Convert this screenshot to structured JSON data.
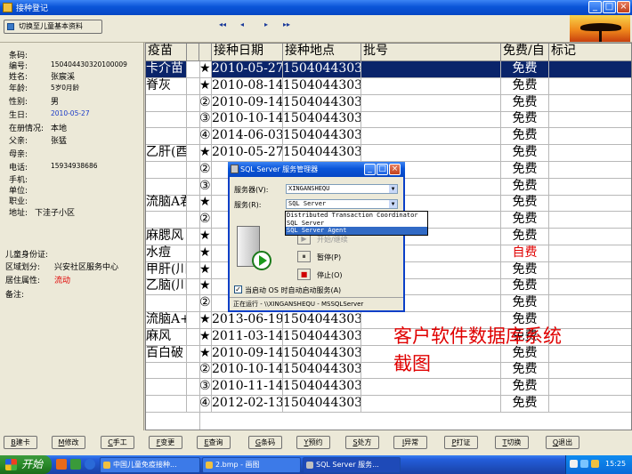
{
  "window": {
    "title": "接种登记",
    "min": "_",
    "max": "□",
    "close": "×"
  },
  "toolbar": {
    "switch_label": "切换至儿童基本资料",
    "nav": [
      "◂◂",
      "◂",
      "▸",
      "▸▸"
    ]
  },
  "left": {
    "fields": [
      {
        "label": "条码:",
        "value": ""
      },
      {
        "label": "编号:",
        "value": "150404430320100009"
      },
      {
        "label": "姓名:",
        "value": "张宸溪"
      },
      {
        "label": "年龄:",
        "value": "5岁0月龄"
      },
      {
        "label": "性别:",
        "value": "男"
      },
      {
        "label": "生日:",
        "value": "2010-05-27"
      },
      {
        "label": "在册情况:",
        "value": "本地"
      },
      {
        "label": "父亲:",
        "value": "张猛"
      },
      {
        "label": "母亲:",
        "value": ""
      },
      {
        "label": "电话:",
        "value": "15934938686"
      },
      {
        "label": "手机:",
        "value": ""
      },
      {
        "label": "单位:",
        "value": ""
      },
      {
        "label": "职业:",
        "value": ""
      },
      {
        "label": "地址:",
        "value": "下洼子小区"
      }
    ],
    "fields2": [
      {
        "label": "儿童身份证:",
        "value": ""
      },
      {
        "label": "区域划分:",
        "value": "兴安社区服务中心"
      },
      {
        "label": "居住属性:",
        "value": "流动"
      },
      {
        "label": "备注:",
        "value": ""
      }
    ],
    "colors": {
      "birthday": "#1a3ac8",
      "residence": "#e00000"
    }
  },
  "grid": {
    "headers": [
      "疫苗",
      "",
      "接种日期",
      "接种地点",
      "批号",
      "免费/自",
      "标记"
    ],
    "rows": [
      [
        "卡介苗",
        "★①",
        "2010-05-27",
        "1504044303",
        "",
        "免费",
        ""
      ],
      [
        "脊灰",
        "★①",
        "2010-08-14",
        "1504044303",
        "",
        "免费",
        ""
      ],
      [
        "",
        "②",
        "2010-09-14",
        "1504044303",
        "",
        "免费",
        ""
      ],
      [
        "",
        "③",
        "2010-10-14",
        "1504044303",
        "",
        "免费",
        ""
      ],
      [
        "",
        "④",
        "2014-06-03",
        "1504044303",
        "",
        "免费",
        ""
      ],
      [
        "乙肝(酉",
        "★①",
        "2010-05-27",
        "1504044303",
        "",
        "免费",
        ""
      ],
      [
        "",
        "②",
        "",
        "",
        "",
        "免费",
        ""
      ],
      [
        "",
        "③",
        "",
        "",
        "",
        "免费",
        ""
      ],
      [
        "流脑A君",
        "★①",
        "",
        "",
        "",
        "免费",
        ""
      ],
      [
        "",
        "②",
        "",
        "",
        "",
        "免费",
        ""
      ],
      [
        "麻腮风",
        "★①",
        "",
        "",
        "",
        "免费",
        ""
      ],
      [
        "水痘",
        "★①",
        "",
        "",
        "",
        "自费",
        ""
      ],
      [
        "甲肝(川",
        "★①",
        "",
        "",
        "",
        "免费",
        ""
      ],
      [
        "乙脑(川",
        "★①",
        "",
        "",
        "",
        "免费",
        ""
      ],
      [
        "",
        "②",
        "",
        "",
        "",
        "免费",
        ""
      ],
      [
        "流脑A+",
        "★①",
        "2013-06-19",
        "1504044303",
        "",
        "免费",
        ""
      ],
      [
        "麻风",
        "★①",
        "2011-03-14",
        "1504044303",
        "",
        "免费",
        ""
      ],
      [
        "百白破",
        "★①",
        "2010-09-14",
        "1504044303",
        "",
        "免费",
        ""
      ],
      [
        "",
        "②",
        "2010-10-14",
        "1504044303",
        "",
        "免费",
        ""
      ],
      [
        "",
        "③",
        "2010-11-14",
        "1504044303",
        "",
        "免费",
        ""
      ],
      [
        "",
        "④",
        "2012-02-13",
        "1504044303",
        "",
        "免费",
        ""
      ]
    ],
    "row_ids": [
      0,
      1,
      2,
      3,
      4,
      5,
      6,
      7,
      8,
      9,
      10,
      11,
      12,
      13,
      14,
      15,
      16,
      17,
      18,
      19,
      20
    ],
    "selected_row": 0
  },
  "dialog": {
    "title": "SQL Server 服务管理器",
    "server_label": "服务器(V):",
    "server_value": "XINGANSHEQU",
    "service_label": "服务(R):",
    "service_value": "SQL Server",
    "options": [
      "Distributed Transaction Coordinator",
      "SQL Server",
      "SQL Server Agent"
    ],
    "start_label": "开始/继续",
    "pause_label": "暂停(P)",
    "stop_label": "停止(O)",
    "autostart_label": "当启动 OS 时自动启动服务(A)",
    "status": "正在运行 - \\\\XINGANSHEQU - MSSQLServer"
  },
  "overlay": {
    "line1": "客户软件数据库系统",
    "line2": "截图"
  },
  "bottom_buttons": [
    "建卡",
    "修改",
    "手工",
    "变更",
    "查询",
    "条码",
    "预约",
    "处方",
    "异常",
    "打证",
    "切换",
    "退出"
  ],
  "taskbar": {
    "start": "开始",
    "tasks": [
      "中国儿童免疫接种...",
      "2.bmp - 画图",
      "SQL Server 服务..."
    ],
    "clock": "15:25"
  }
}
